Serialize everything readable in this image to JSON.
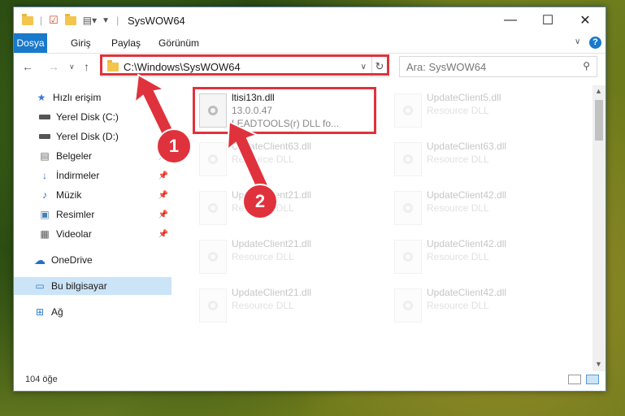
{
  "window": {
    "title": "SysWOW64",
    "controls": {
      "minimize": "—",
      "maximize": "☐",
      "close": "✕"
    }
  },
  "ribbon": {
    "tabs": [
      {
        "label": "Dosya"
      },
      {
        "label": "Giriş"
      },
      {
        "label": "Paylaş"
      },
      {
        "label": "Görünüm"
      }
    ]
  },
  "navigation": {
    "address": "C:\\Windows\\SysWOW64",
    "search_placeholder": "Ara: SysWOW64"
  },
  "sidebar": {
    "items": [
      {
        "label": "Hızlı erişim",
        "icon": "star-icon"
      },
      {
        "label": "Yerel Disk (C:)",
        "icon": "drive-icon"
      },
      {
        "label": "Yerel Disk (D:)",
        "icon": "drive-icon"
      },
      {
        "label": "Belgeler",
        "icon": "documents-icon"
      },
      {
        "label": "İndirmeler",
        "icon": "download-icon"
      },
      {
        "label": "Müzik",
        "icon": "music-icon"
      },
      {
        "label": "Resimler",
        "icon": "pictures-icon"
      },
      {
        "label": "Videolar",
        "icon": "videos-icon"
      },
      {
        "label": "OneDrive",
        "icon": "cloud-icon"
      },
      {
        "label": "Bu bilgisayar",
        "icon": "computer-icon"
      },
      {
        "label": "Ağ",
        "icon": "network-icon"
      }
    ]
  },
  "files": [
    {
      "name": "ltisi13n.dll",
      "line1": "13.0.0.47",
      "line2": "LEADTOOLS(r) DLL fo..."
    },
    {
      "name": "UpdateClient5.dll",
      "line1": "Resource DLL",
      "line2": ""
    },
    {
      "name": "UpdateClient63.dll",
      "line1": "Resource DLL",
      "line2": ""
    },
    {
      "name": "UpdateClient63.dll",
      "line1": "Resource DLL",
      "line2": ""
    },
    {
      "name": "UpdateClient21.dll",
      "line1": "Resource DLL",
      "line2": ""
    },
    {
      "name": "UpdateClient42.dll",
      "line1": "Resource DLL",
      "line2": ""
    },
    {
      "name": "UpdateClient21.dll",
      "line1": "Resource DLL",
      "line2": ""
    },
    {
      "name": "UpdateClient42.dll",
      "line1": "Resource DLL",
      "line2": ""
    },
    {
      "name": "UpdateClient21.dll",
      "line1": "Resource DLL",
      "line2": ""
    },
    {
      "name": "UpdateClient42.dll",
      "line1": "Resource DLL",
      "line2": ""
    }
  ],
  "status": {
    "item_count": "104 öğe"
  },
  "annotations": {
    "step1": "1",
    "step2": "2",
    "accent": "#e0323c"
  }
}
